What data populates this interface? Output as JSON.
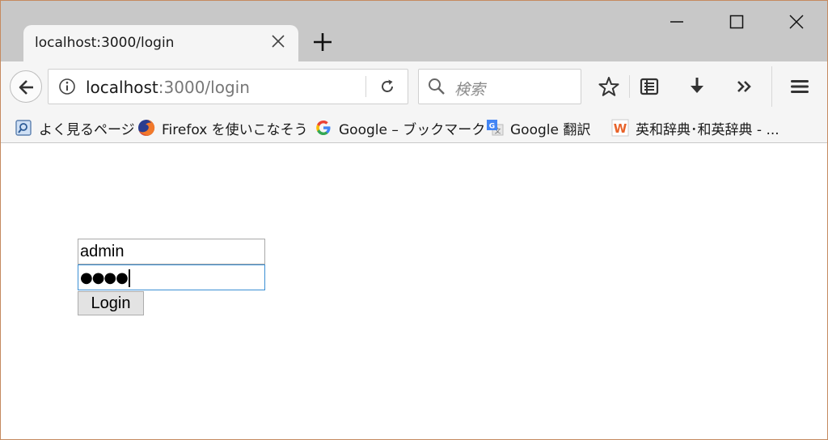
{
  "window": {
    "controls": {
      "minimize": "minimize-icon",
      "maximize": "maximize-icon",
      "close": "close-icon"
    }
  },
  "tab": {
    "title": "localhost:3000/login",
    "close_icon": "close-icon",
    "new_tab_icon": "plus-icon"
  },
  "toolbar": {
    "url_host": "localhost",
    "url_path": ":3000/login",
    "search_placeholder": "検索",
    "icons": [
      "back-arrow-icon",
      "info-icon",
      "reload-icon",
      "search-icon",
      "star-icon",
      "reading-list-icon",
      "download-icon",
      "overflow-chevron-icon",
      "hamburger-menu-icon"
    ]
  },
  "bookmarks": [
    {
      "label": "よく見るページ",
      "icon": "most-visited-icon"
    },
    {
      "label": "Firefox を使いこなそう",
      "icon": "firefox-icon"
    },
    {
      "label": "Google – ブックマーク",
      "icon": "google-icon"
    },
    {
      "label": "Google 翻訳",
      "icon": "google-translate-icon"
    },
    {
      "label": "英和辞典･和英辞典 - ...",
      "icon": "weblio-icon"
    }
  ],
  "form": {
    "username": "admin",
    "password_masked": "●●●●",
    "login_label": "Login"
  },
  "colors": {
    "tabstrip": "#c8c8c8",
    "toolbar": "#f5f5f5",
    "window_border": "#c58a5f",
    "focus_border": "#3b8fd4"
  }
}
